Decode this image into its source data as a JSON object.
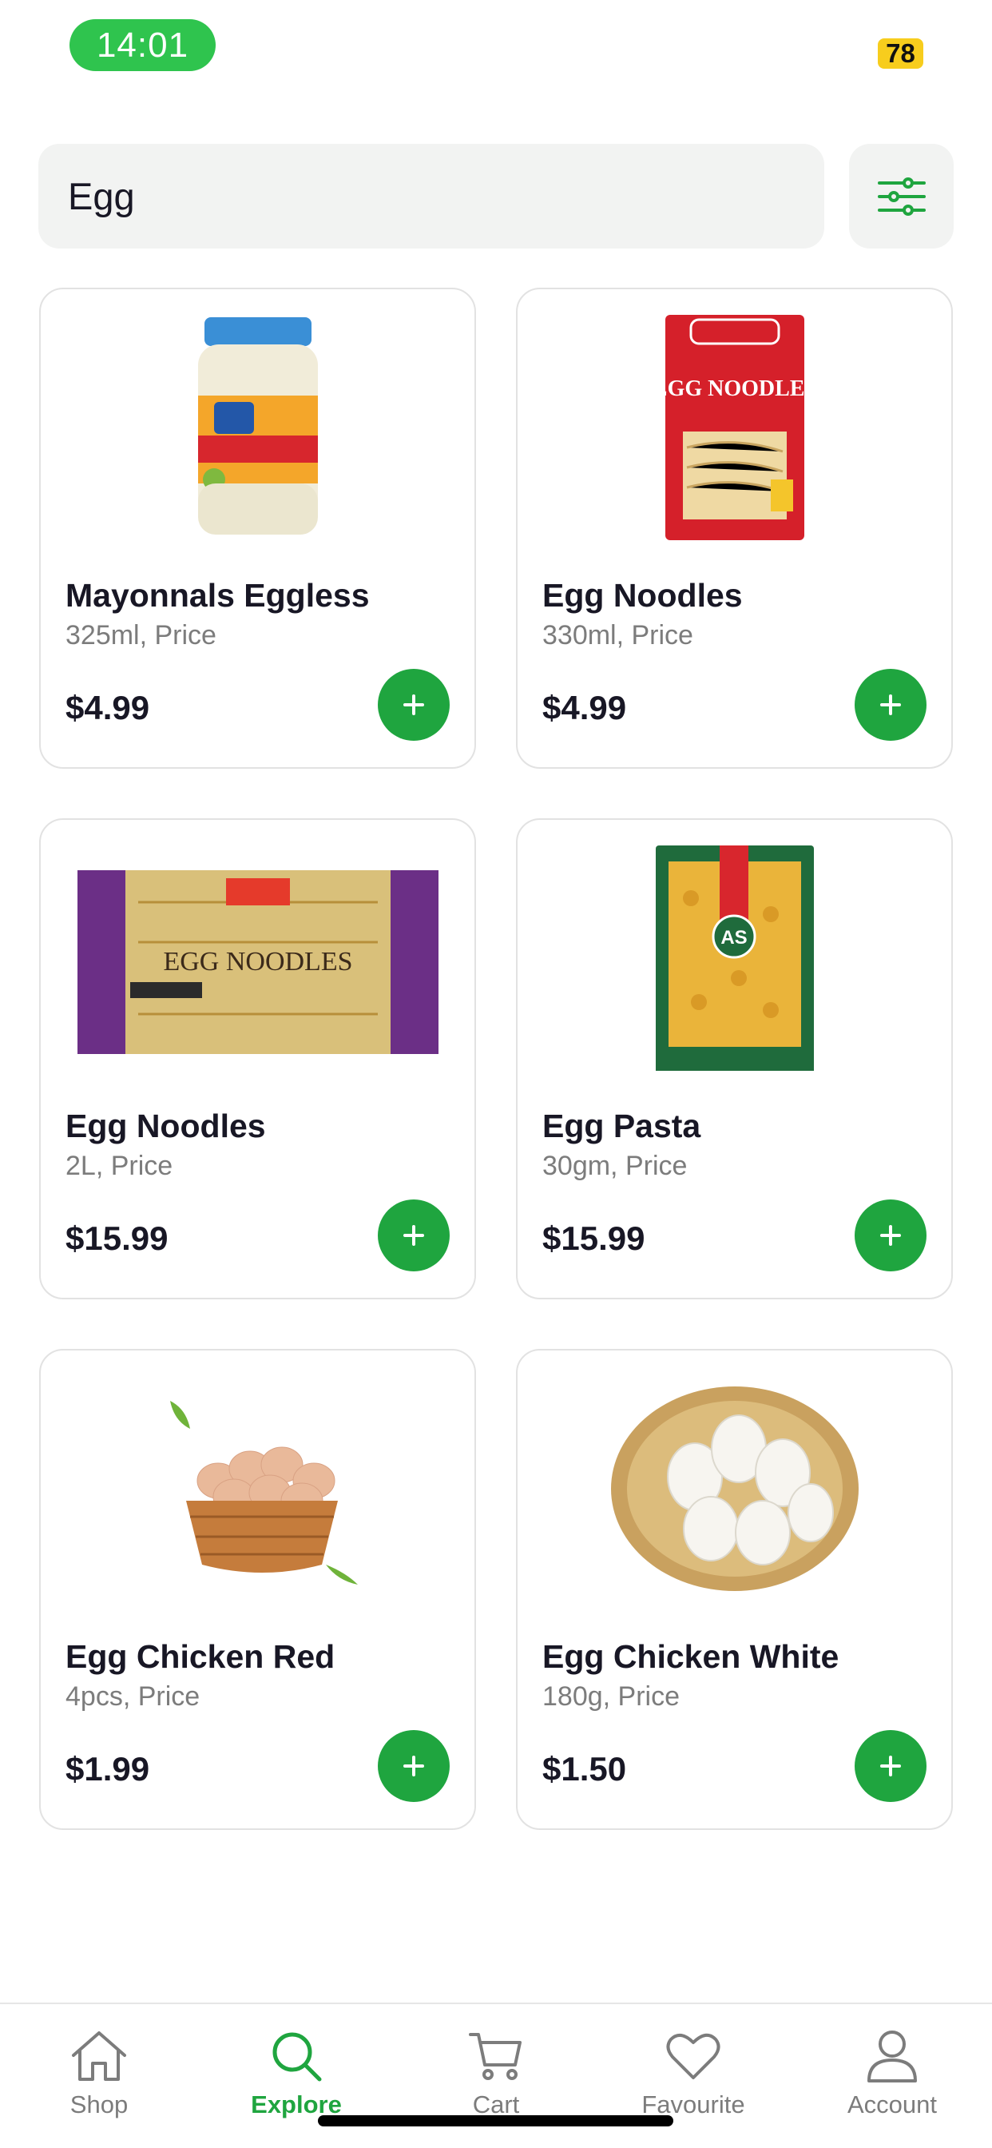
{
  "status_bar": {
    "time": "14:01",
    "battery": "78"
  },
  "search": {
    "value": "Egg"
  },
  "products": [
    {
      "name": "Mayonnals Eggless",
      "detail": "325ml, Price",
      "price": "$4.99"
    },
    {
      "name": "Egg Noodles",
      "detail": "330ml, Price",
      "price": "$4.99",
      "package_text": "EGG NOODLES"
    },
    {
      "name": "Egg Noodles",
      "detail": "2L, Price",
      "price": "$15.99",
      "package_text": "EGG NOODLES"
    },
    {
      "name": "Egg Pasta",
      "detail": "30gm, Price",
      "price": "$15.99",
      "package_text": "AS"
    },
    {
      "name": "Egg Chicken Red",
      "detail": "4pcs, Price",
      "price": "$1.99"
    },
    {
      "name": "Egg Chicken White",
      "detail": "180g, Price",
      "price": "$1.50"
    }
  ],
  "nav": {
    "items": [
      {
        "label": "Shop",
        "icon": "home-icon"
      },
      {
        "label": "Explore",
        "icon": "search-icon"
      },
      {
        "label": "Cart",
        "icon": "cart-icon"
      },
      {
        "label": "Favourite",
        "icon": "heart-icon"
      },
      {
        "label": "Account",
        "icon": "user-icon"
      }
    ],
    "active": "Explore"
  },
  "colors": {
    "accent": "#1fa53f",
    "card_border": "#e2e2e2",
    "muted": "#7c7c7c"
  }
}
